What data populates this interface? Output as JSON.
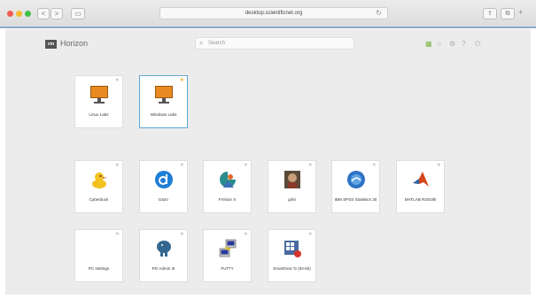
{
  "browser": {
    "url": "desktop.scientificnet.org",
    "nav_back": "<",
    "nav_forward": ">",
    "reload": "↻",
    "new_tab": "+"
  },
  "header": {
    "logo_badge": "vm",
    "logo_text": "Horizon",
    "search_placeholder": "Search"
  },
  "toolbar": {
    "grid": "▦",
    "star": "☆",
    "settings": "⚙",
    "help": "?",
    "logout": "⏻"
  },
  "desktops": [
    {
      "label": "Linux Labs",
      "favorite": false,
      "selected": false
    },
    {
      "label": "Windows Labs",
      "favorite": true,
      "selected": true
    }
  ],
  "apps": [
    {
      "label": "Cyberduck",
      "icon": "duck-icon"
    },
    {
      "label": "Dazo",
      "icon": "dazo-icon"
    },
    {
      "label": "FVision X",
      "icon": "fvision-icon"
    },
    {
      "label": "gimt",
      "icon": "gimp-icon"
    },
    {
      "label": "IBM SPSS Statistics 20",
      "icon": "spss-icon"
    },
    {
      "label": "MATLAB R2019b",
      "icon": "matlab-icon"
    },
    {
      "label": "PC settings",
      "icon": "blank-icon"
    },
    {
      "label": "PG Admin III",
      "icon": "elephant-icon"
    },
    {
      "label": "PuTTY",
      "icon": "putty-icon"
    },
    {
      "label": "SmartGea 'G (64-bit)",
      "icon": "smartgit-icon"
    }
  ],
  "colors": {
    "accent": "#5fa7d8",
    "favorite": "#f2b530",
    "page_bg": "#ececec"
  }
}
